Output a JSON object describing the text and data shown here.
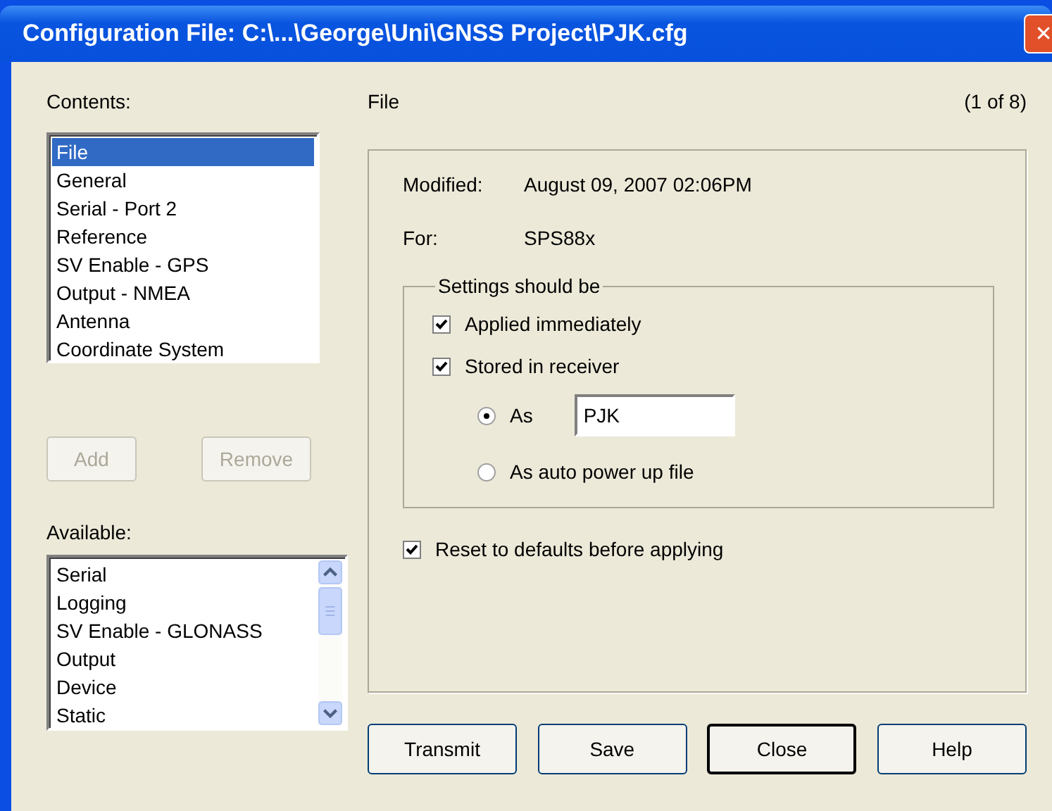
{
  "window": {
    "title": "Configuration File: C:\\...\\George\\Uni\\GNSS Project\\PJK.cfg",
    "close_button": "✕"
  },
  "contents": {
    "label": "Contents:",
    "items": [
      {
        "label": "File",
        "selected": true
      },
      {
        "label": "General",
        "selected": false
      },
      {
        "label": "Serial - Port 2",
        "selected": false
      },
      {
        "label": "Reference",
        "selected": false
      },
      {
        "label": "SV Enable - GPS",
        "selected": false
      },
      {
        "label": "Output - NMEA",
        "selected": false
      },
      {
        "label": "Antenna",
        "selected": false
      },
      {
        "label": "Coordinate System",
        "selected": false
      }
    ]
  },
  "list_buttons": [
    {
      "label": "Add",
      "disabled": true
    },
    {
      "label": "Remove",
      "disabled": true
    }
  ],
  "available": {
    "label": "Available:",
    "items": [
      {
        "label": "Serial",
        "selected": false
      },
      {
        "label": "Logging",
        "selected": false
      },
      {
        "label": "SV Enable - GLONASS",
        "selected": false
      },
      {
        "label": "Output",
        "selected": false
      },
      {
        "label": "Device",
        "selected": false
      },
      {
        "label": "Static",
        "selected": false
      }
    ]
  },
  "page": {
    "title": "File",
    "counter": "(1 of 8)",
    "fields": [
      {
        "label": "Modified:",
        "value": "August 09, 2007 02:06PM"
      },
      {
        "label": "For:",
        "value": "SPS88x"
      }
    ],
    "settings": {
      "label": "Settings should be",
      "checks": [
        {
          "label": "Applied immediately",
          "checked": true
        },
        {
          "label": "Stored in receiver",
          "checked": true
        }
      ],
      "radios": [
        {
          "label": "As",
          "selected": true,
          "value": "PJK"
        },
        {
          "label": "As auto power up file",
          "selected": false
        }
      ]
    },
    "reset": {
      "label": "Reset to defaults before applying",
      "checked": true
    }
  },
  "buttons": [
    {
      "label": "Transmit",
      "default": false
    },
    {
      "label": "Save",
      "default": false
    },
    {
      "label": "Close",
      "default": true
    },
    {
      "label": "Help",
      "default": false
    }
  ]
}
